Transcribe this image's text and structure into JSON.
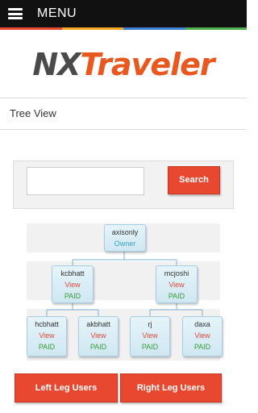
{
  "header": {
    "menu_label": "MENU",
    "stripe_colors": [
      "#e8482f",
      "#f5a623",
      "#3c7fd6",
      "#4caf50"
    ]
  },
  "logo": {
    "part1": "NX",
    "part2": "Traveler",
    "color1": "#4a4a4a",
    "color2": "#e8581f"
  },
  "page": {
    "title": "Tree View"
  },
  "search": {
    "value": "",
    "button_label": "Search"
  },
  "tree": {
    "root": {
      "name": "axisonly",
      "role": "Owner"
    },
    "level1": [
      {
        "name": "kcbhatt",
        "link": "View",
        "status": "PAID"
      },
      {
        "name": "mcjoshi",
        "link": "View",
        "status": "PAID"
      }
    ],
    "level2": [
      {
        "name": "hcbhatt",
        "link": "View",
        "status": "PAID"
      },
      {
        "name": "akbhatt",
        "link": "View",
        "status": "PAID"
      },
      {
        "name": "rj",
        "link": "View",
        "status": "PAID"
      },
      {
        "name": "daxa",
        "link": "View",
        "status": "PAID"
      }
    ]
  },
  "buttons": {
    "left_leg": "Left Leg Users",
    "right_leg": "Right Leg Users"
  }
}
